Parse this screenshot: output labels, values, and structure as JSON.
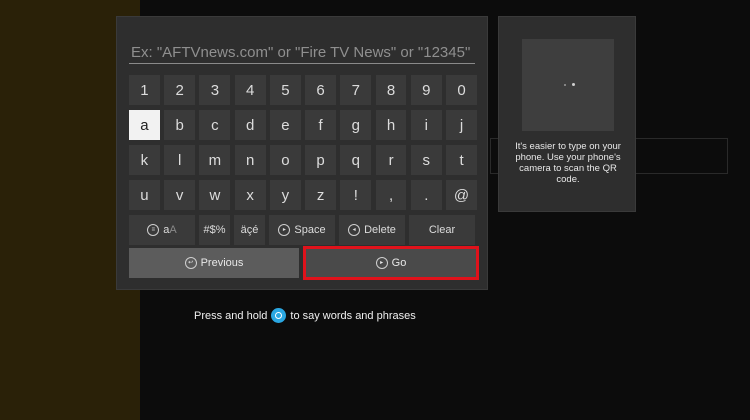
{
  "search": {
    "placeholder": "Ex: \"AFTVnews.com\" or \"Fire TV News\" or \"12345\""
  },
  "keyboard": {
    "rows": [
      [
        "1",
        "2",
        "3",
        "4",
        "5",
        "6",
        "7",
        "8",
        "9",
        "0"
      ],
      [
        "a",
        "b",
        "c",
        "d",
        "e",
        "f",
        "g",
        "h",
        "i",
        "j"
      ],
      [
        "k",
        "l",
        "m",
        "n",
        "o",
        "p",
        "q",
        "r",
        "s",
        "t"
      ],
      [
        "u",
        "v",
        "w",
        "x",
        "y",
        "z",
        "!",
        ",",
        ".",
        "@"
      ]
    ],
    "focused_key": "a",
    "function_keys": {
      "case_label_primary": "a",
      "case_label_secondary": "A",
      "symbols": "#$%",
      "accents": "äçé",
      "space": "Space",
      "delete": "Delete",
      "clear": "Clear"
    }
  },
  "nav": {
    "previous": "Previous",
    "go": "Go"
  },
  "qr": {
    "instructions": "It's easier to type on your phone. Use your phone's camera to scan the QR code."
  },
  "voice_hint": {
    "before": "Press and hold",
    "after": "to say words and phrases"
  },
  "colors": {
    "focus_highlight": "#e0121b",
    "voice_icon": "#2aa7e2"
  }
}
